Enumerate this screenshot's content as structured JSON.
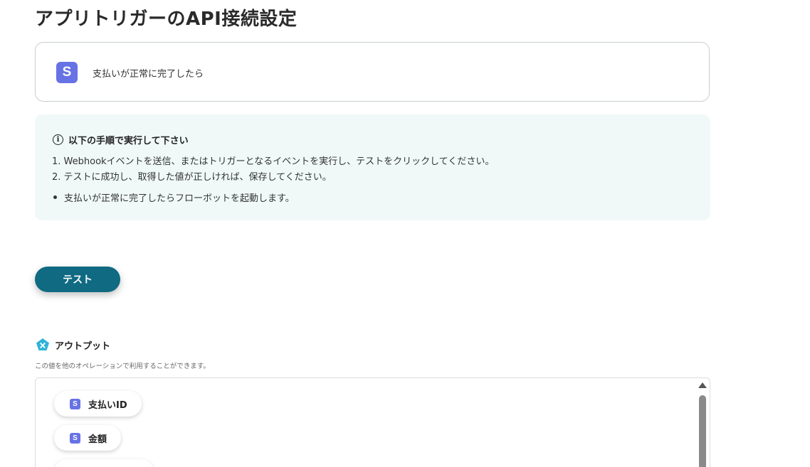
{
  "page_title": "アプリトリガーのAPI接続設定",
  "trigger": {
    "icon_letter": "S",
    "label": "支払いが正常に完了したら"
  },
  "instructions": {
    "heading": "以下の手順で実行して下さい",
    "steps": [
      "1. Webhookイベントを送信、またはトリガーとなるイベントを実行し、テストをクリックしてください。",
      "2. テストに成功し、取得した値が正しければ、保存してください。"
    ],
    "bullet": "支払いが正常に完了したらフローボットを起動します。"
  },
  "test_button_label": "テスト",
  "output": {
    "heading": "アウトプット",
    "description": "この値を他のオペレーションで利用することができます。",
    "items": [
      {
        "icon_letter": "S",
        "label": "支払いID"
      },
      {
        "icon_letter": "S",
        "label": "金額"
      },
      {
        "icon_letter": "",
        "label": ""
      }
    ]
  },
  "colors": {
    "stripe_icon": "#6772e5",
    "button": "#0f6a82",
    "info_bg": "#f0f9f8",
    "output_icon": "#2fb3d8"
  },
  "icons": {
    "info": "info-circle-icon",
    "output": "output-pentagon-icon",
    "app": "stripe-s-icon"
  }
}
